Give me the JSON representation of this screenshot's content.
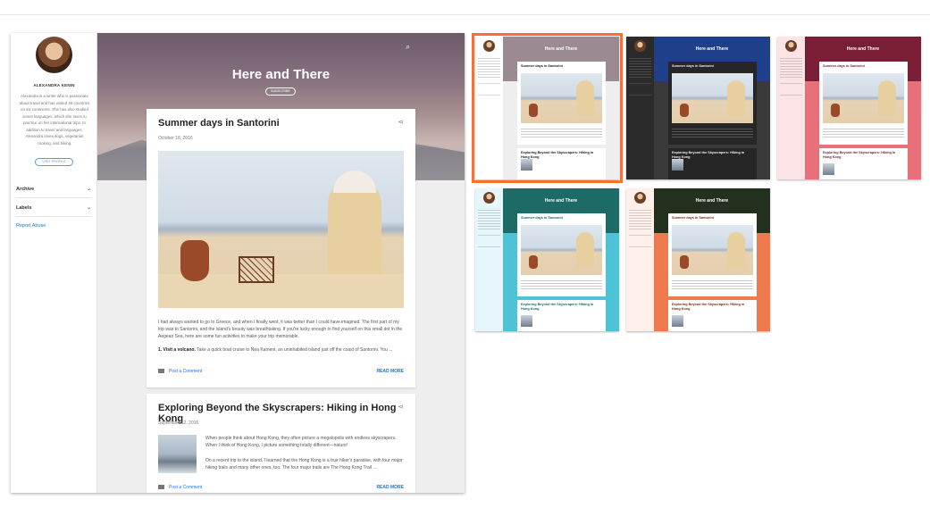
{
  "preview": {
    "author_name": "ALEXANDRA KENIN",
    "bio": "Alexandra is a writer who is passionate about travel and has visited 46 countries on six continents. She has also studied seven languages, which she loves to practice on her international trips. In addition to travel and languages, Alexandra loves dogs, vegetarian cooking, and hiking.",
    "visit_profile": "VISIT PROFILE",
    "sidebar_items": [
      {
        "label": "Archive"
      },
      {
        "label": "Labels"
      }
    ],
    "report_abuse": "Report Abuse",
    "blog_title": "Here and There",
    "subscribe": "SUBSCRIBE",
    "search_icon": "search-icon",
    "posts": [
      {
        "title": "Summer days in Santorini",
        "date": "October 18, 2016",
        "body": "I had always wanted to go to Greece, and when I finally went, it was better than I could have imagined. The first part of my trip was to Santorini, and the island's beauty was breathtaking. If you're lucky enough to find yourself on this small dot in the Aegean Sea, here are some fun activities to make your trip memorable.",
        "item_label": "1. Visit a volcano.",
        "item_text": " Take a quick boat cruise to Nea Kameni, an uninhabited island just off the coast of Santorini. You ...",
        "comment_label": "Post a Comment",
        "read_more": "READ MORE"
      },
      {
        "title": "Exploring Beyond the Skyscrapers: Hiking in Hong Kong",
        "date": "September 12, 2016",
        "body": "When people think about Hong Kong, they often picture a megalopolis with endless skyscrapers. When I think of Hong Kong, I picture something totally different—nature!",
        "body2": "On a recent trip to the island, I learned that the Hong Kong is a true hiker's paradise, with four major hiking trails and many other ones, too. The four major trails are The Hong Kong Trail ...",
        "comment_label": "Post a Comment",
        "read_more": "READ MORE"
      }
    ]
  },
  "themes": [
    {
      "title": "Here and There",
      "post1": "Summer days in Santorini",
      "post2": "Exploring Beyond the Skyscrapers: Hiking in Hong Kong",
      "selected": true,
      "side": "#ffffff",
      "head": "#9c8a93",
      "body": "#eeeeee",
      "card": "#ffffff",
      "text": "#222222"
    },
    {
      "title": "Here and There",
      "post1": "Summer days in Santorini",
      "post2": "Exploring Beyond the Skyscrapers: Hiking in Hong Kong",
      "selected": false,
      "side": "#2b2b2b",
      "head": "#1f3f8a",
      "body": "#3a3a3a",
      "card": "#262626",
      "text": "#eeeeee"
    },
    {
      "title": "Here and There",
      "post1": "Summer days in Santorini",
      "post2": "Exploring Beyond the Skyscrapers: Hiking in Hong Kong",
      "selected": false,
      "side": "#fbe3e6",
      "head": "#7a1e35",
      "body": "#e8707a",
      "card": "#ffffff",
      "text": "#7a1e35"
    },
    {
      "title": "Here and There",
      "post1": "Summer days in Santorini",
      "post2": "Exploring Beyond the Skyscrapers: Hiking in Hong Kong",
      "selected": false,
      "side": "#e6f7fb",
      "head": "#1d6b66",
      "body": "#4fc3d6",
      "card": "#ffffff",
      "text": "#1d6b66"
    },
    {
      "title": "Here and There",
      "post1": "Summer days in Santorini",
      "post2": "Exploring Beyond the Skyscrapers: Hiking in Hong Kong",
      "selected": false,
      "side": "#fff1ea",
      "head": "#24301e",
      "body": "#f07a4f",
      "card": "#ffffff",
      "text": "#7a2a12"
    }
  ]
}
